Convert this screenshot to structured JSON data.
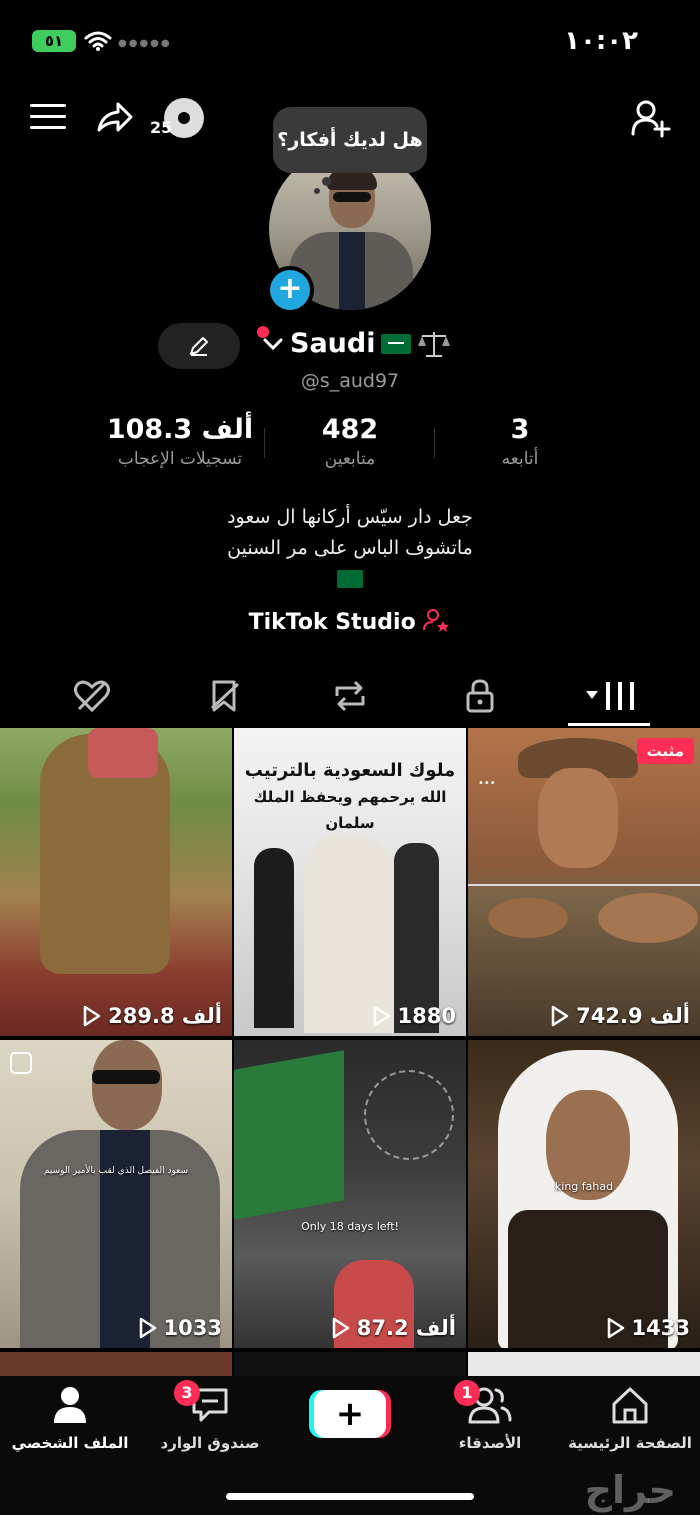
{
  "status_bar": {
    "battery": "٥١",
    "time": "١٠:٠٢"
  },
  "header": {
    "disc_count": "25"
  },
  "thought_bubble": "هل لديك أفكار؟",
  "profile": {
    "name": "Saudi",
    "handle": "@s_aud97",
    "stats": [
      {
        "value": "108.3 ألف",
        "label": "تسجيلات الإعجاب"
      },
      {
        "value": "482",
        "label": "متابعين"
      },
      {
        "value": "3",
        "label": "أتابعه"
      }
    ],
    "bio": [
      "جعل دار سيّس أركانها ال سعود",
      "ماتشوف الباس على مر السنين"
    ],
    "studio_link": "TikTok Studio"
  },
  "videos": [
    {
      "views": "289.8 ألف"
    },
    {
      "views": "1880",
      "title_line1": "ملوك السعودية بالترتيب",
      "title_line2": "الله يرحمهم ويحفظ الملك سلمان"
    },
    {
      "views": "742.9 ألف",
      "badge": "مثبت"
    },
    {
      "views": "1033",
      "caption": "سعود الفيصل الذي لقب بالأمير الوسيم"
    },
    {
      "views": "87.2 ألف",
      "caption": "Only 18 days left!"
    },
    {
      "views": "1433",
      "caption": "king fahad"
    }
  ],
  "bottom_nav": {
    "home": "الصفحة الرئيسية",
    "friends": "الأصدقاء",
    "friends_badge": "1",
    "inbox": "صندوق الوارد",
    "inbox_badge": "3",
    "profile": "الملف الشخصي"
  },
  "watermark": "حراج",
  "colors": {
    "accent_red": "#ff2d55",
    "avatar_add_blue": "#21a7e0",
    "battery_green": "#3fcd5e",
    "flag_green": "#006c35"
  }
}
